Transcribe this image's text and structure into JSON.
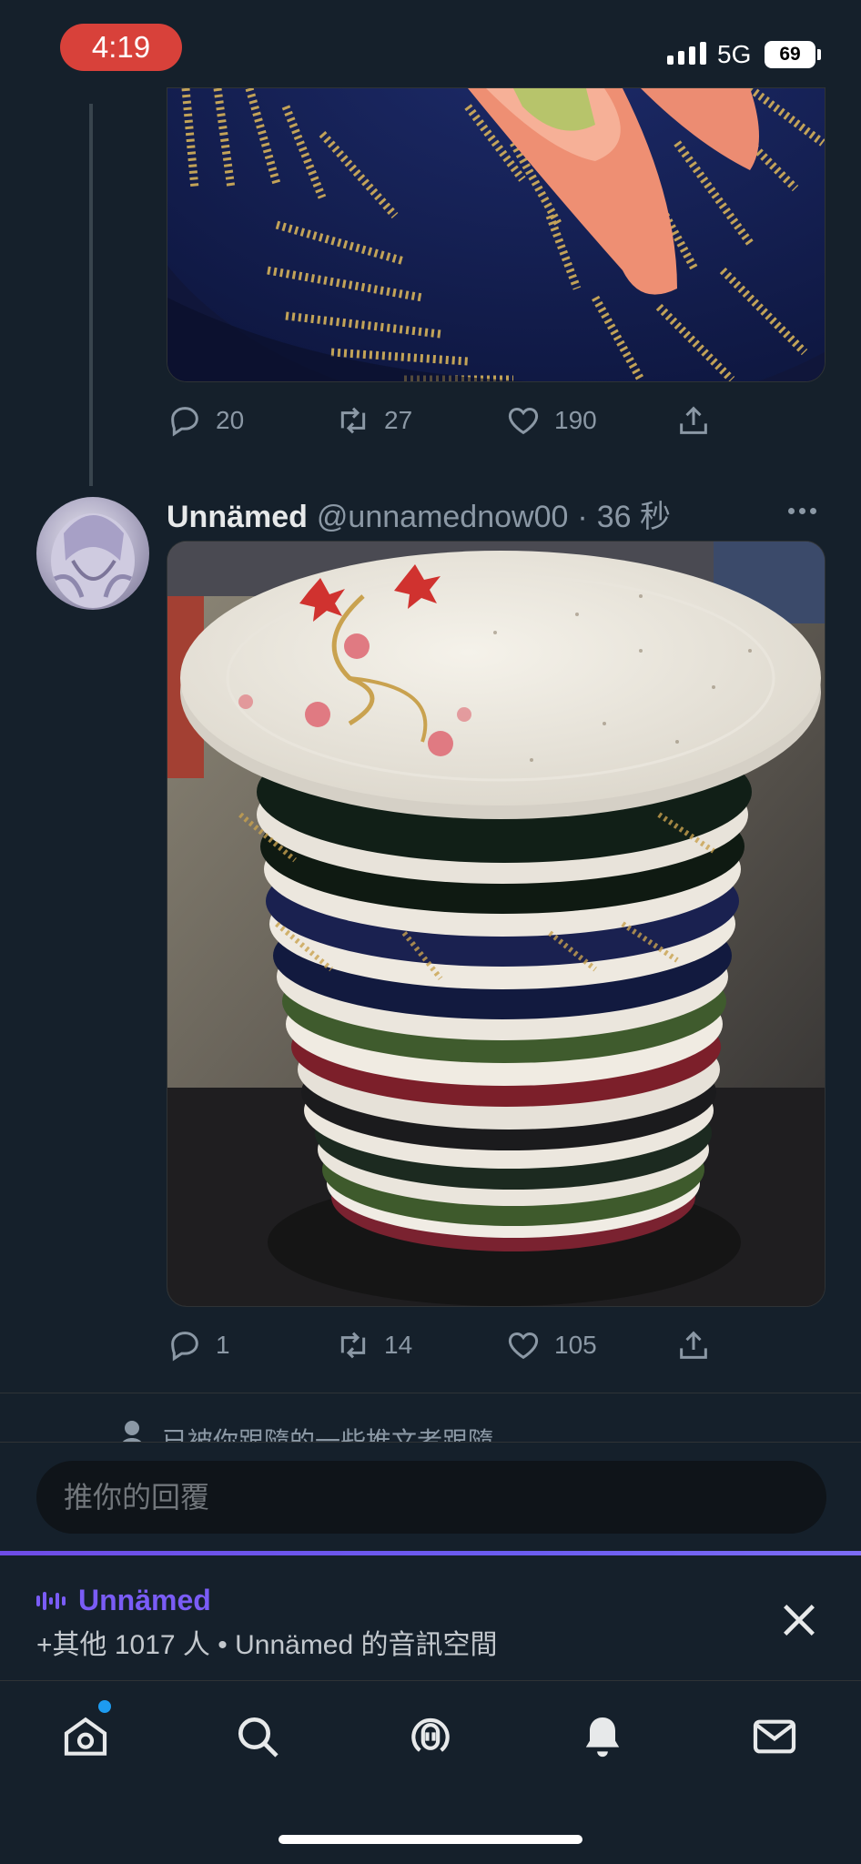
{
  "status_bar": {
    "time": "4:19",
    "network": "5G",
    "battery": "69"
  },
  "prev_tweet": {
    "actions": {
      "replies": "20",
      "retweets": "27",
      "likes": "190"
    }
  },
  "tweet": {
    "name": "Unnämed",
    "handle": "@unnamednow00",
    "dot": "·",
    "time": "36 秒",
    "actions": {
      "replies": "1",
      "retweets": "14",
      "likes": "105"
    }
  },
  "social_context": "已被你跟隨的一些推文者跟隨",
  "reply": {
    "placeholder": "推你的回覆"
  },
  "space": {
    "host": "Unnämed",
    "subtitle": "+其他 1017 人 • Unnämed 的音訊空間",
    "accent": "#7a5cf6"
  },
  "nav": {
    "items": [
      "home-icon",
      "search-icon",
      "spaces-icon",
      "notifications-icon",
      "messages-icon"
    ],
    "home_badge_color": "#1d9bf0"
  }
}
